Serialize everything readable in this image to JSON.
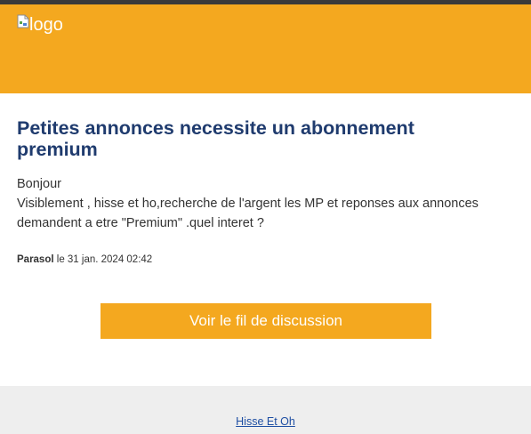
{
  "header": {
    "logo_alt": "logo"
  },
  "post": {
    "title": "Petites annonces necessite un abonnement premium",
    "greeting": "Bonjour",
    "body": "Visiblement , hisse et ho,recherche de l'argent les MP et reponses aux annonces demandent a etre \"Premium\" .quel interet ?",
    "author": "Parasol",
    "date_text": " le 31 jan. 2024 02:42"
  },
  "cta": {
    "label": "Voir le fil de discussion"
  },
  "footer": {
    "link_label": "Hisse Et Oh"
  },
  "colors": {
    "accent": "#f4a81f",
    "title": "#1f3b6e",
    "link": "#1f4fa3",
    "footer_bg": "#eeeeee"
  },
  "icons": {
    "logo": "broken-image-icon"
  }
}
